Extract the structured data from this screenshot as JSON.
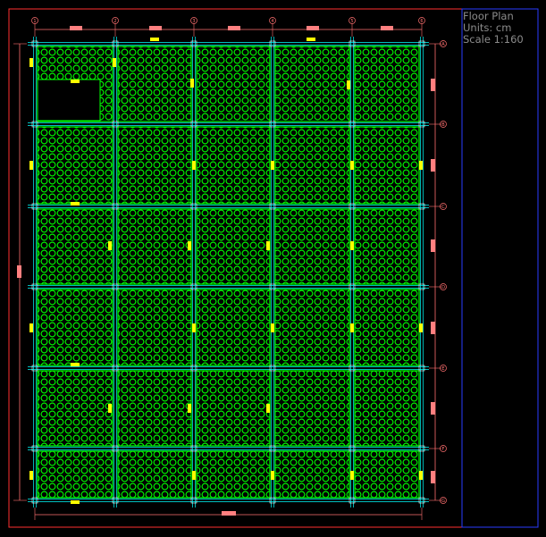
{
  "title_block": {
    "title": "Floor Plan",
    "units": "Units: cm",
    "scale": "Scale 1:160"
  },
  "axes": {
    "columns": [
      "1",
      "2",
      "3",
      "4",
      "5",
      "6"
    ],
    "rows": [
      "A",
      "B",
      "C",
      "D",
      "E",
      "F",
      "G"
    ]
  },
  "colors": {
    "background": "#000000",
    "frame": "#ff3030",
    "title_panel": "#2a3cff",
    "gridline": "#00ffff",
    "dimension": "#ff7070",
    "panel": "#00ff00",
    "marker": "#ffff00",
    "tag": "#ff8080",
    "title_text": "#8b8b8b"
  },
  "layout_notes": {
    "cutout_panel": "row A / bay 1-2 contains an open rectangular void",
    "bays": 5,
    "spans": 6
  }
}
